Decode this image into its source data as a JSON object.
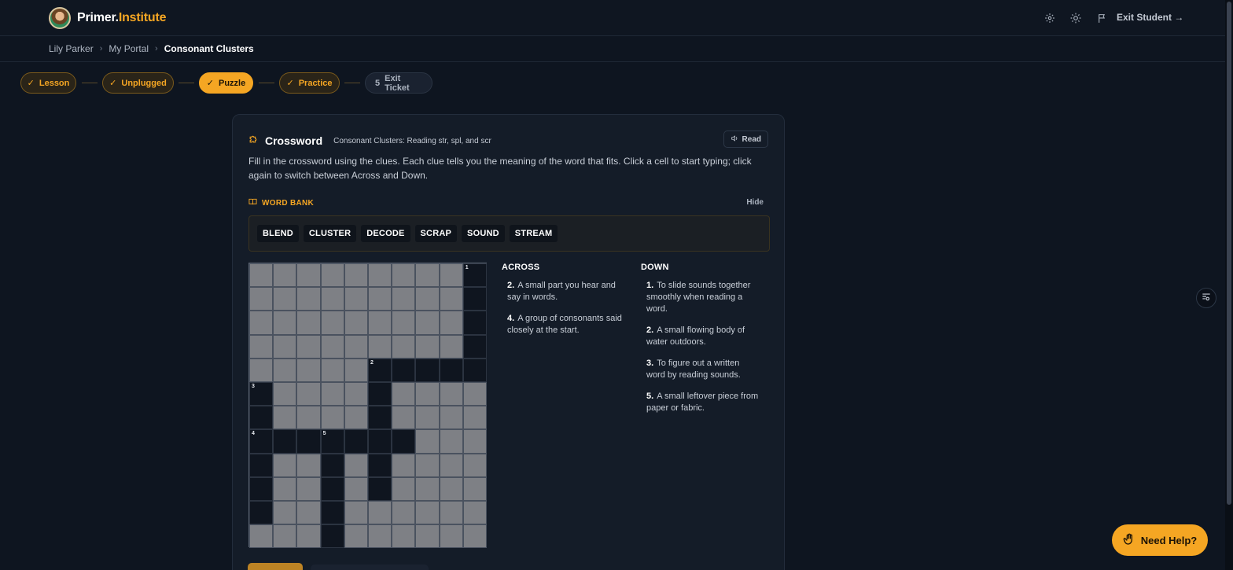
{
  "brand": {
    "name_part1": "Primer.",
    "name_part2": "Institute"
  },
  "header": {
    "icons": [
      "gear-icon",
      "sun-icon",
      "flag-icon"
    ],
    "exit_label": "Exit Student →"
  },
  "breadcrumb": [
    "Lily Parker",
    "My Portal",
    "Consonant Clusters"
  ],
  "stepper": {
    "steps": [
      {
        "label": "Lesson",
        "state": "done",
        "marker": "✓"
      },
      {
        "label": "Unplugged",
        "state": "done",
        "marker": "✓"
      },
      {
        "label": "Puzzle",
        "state": "active",
        "marker": "✓"
      },
      {
        "label": "Practice",
        "state": "done",
        "marker": "✓"
      },
      {
        "label": "Exit Ticket",
        "state": "todo",
        "marker": "5"
      }
    ]
  },
  "card": {
    "title": "Crossword",
    "subtitle": "Consonant Clusters: Reading str, spl, and scr",
    "read_label": "Read",
    "instructions": "Fill in the crossword using the clues. Each clue tells you the meaning of the word that fits. Click a cell to start typing; click again to switch between Across and Down."
  },
  "word_bank": {
    "heading": "WORD BANK",
    "hide_label": "Hide",
    "words": [
      "BLEND",
      "CLUSTER",
      "DECODE",
      "SCRAP",
      "SOUND",
      "STREAM"
    ]
  },
  "crossword": {
    "rows": [
      "#########.",
      "#########.",
      "#########.",
      "#########.",
      "#####.....",
      ".####.####",
      ".####.####",
      ".......###",
      ".##.#.####",
      ".##.#.####",
      ".##.######",
      "###.######"
    ],
    "numbers": [
      {
        "row": 0,
        "col": 9,
        "n": "1"
      },
      {
        "row": 4,
        "col": 5,
        "n": "2"
      },
      {
        "row": 5,
        "col": 0,
        "n": "3"
      },
      {
        "row": 7,
        "col": 0,
        "n": "4"
      },
      {
        "row": 7,
        "col": 3,
        "n": "5"
      }
    ]
  },
  "clues": {
    "across_title": "ACROSS",
    "across": [
      {
        "n": "2.",
        "text": "A small part you hear and say in words."
      },
      {
        "n": "4.",
        "text": "A group of consonants said closely at the start."
      }
    ],
    "down_title": "DOWN",
    "down": [
      {
        "n": "1.",
        "text": "To slide sounds together smoothly when reading a word."
      },
      {
        "n": "2.",
        "text": "A small flowing body of water outdoors."
      },
      {
        "n": "3.",
        "text": "To figure out a written word by reading sounds."
      },
      {
        "n": "5.",
        "text": "A small leftover piece from paper or fabric."
      }
    ]
  },
  "help": {
    "label": "Need Help?"
  },
  "colors": {
    "accent": "#f5a623",
    "background": "#0e1520",
    "card": "#141c28"
  }
}
